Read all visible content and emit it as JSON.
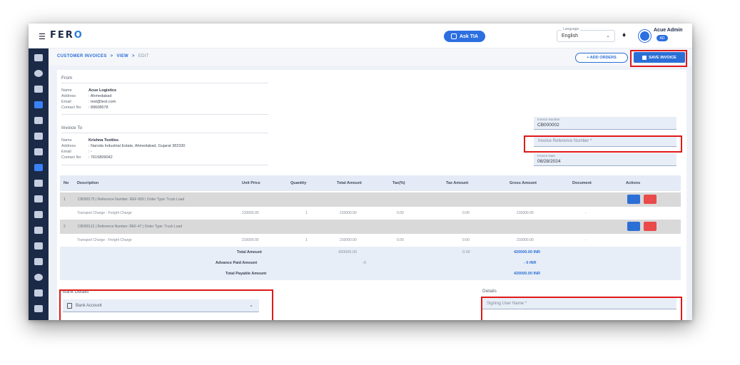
{
  "header": {
    "logo_prefix": "FER",
    "logo_suffix": "O",
    "ask_button": "Ask TIA",
    "language_label": "Language",
    "language_value": "English",
    "user_name": "Acue Admin",
    "user_role": "AD"
  },
  "breadcrumb": {
    "root": "CUSTOMER INVOICES",
    "mid": "VIEW",
    "current": "EDIT"
  },
  "actions": {
    "add_orders": "+ ADD ORDERS",
    "save_invoice": "SAVE INVOICE"
  },
  "from": {
    "title": "From",
    "name_key": "Name",
    "name": "Acue Logistics",
    "address_key": "Address",
    "address": ": Ahmedabad",
    "email_key": "Email",
    "email": ": test@test.com",
    "contact_key": "Contact No",
    "contact": ": 89608678"
  },
  "invoice_to": {
    "title": "Invoice To",
    "name_key": "Name",
    "name": "Krishna Textiles",
    "address_key": "Address",
    "address": ": Naroda Industrial Estate, Ahmedabad, Gujarat 382330",
    "email_key": "Email",
    "email": ": -",
    "contact_key": "Contact No",
    "contact": ": 7615809042"
  },
  "fields": {
    "invoice_number_label": "Invoice Number",
    "invoice_number": "CB000002",
    "ref_placeholder": "Invoice Reference Number *",
    "invoice_date_label": "Invoice Date",
    "invoice_date": "08/28/2024"
  },
  "table": {
    "headers": [
      "No",
      "Description",
      "Unit Price",
      "Quantity",
      "Total Amount",
      "Tax(%)",
      "Tax Amount",
      "Gross Amount",
      "Document",
      "Actions"
    ],
    "groups": [
      {
        "no": "1",
        "title": "CB000175 | Reference Number: REF-999 | Order Type: Truck Load",
        "row": {
          "description": "Transport Charge - Freight Charge",
          "unit_price": "210000.00",
          "qty": "1",
          "total": "210000.00",
          "tax_pct": "0.00",
          "tax_amount": "0.00",
          "gross": "210000.00",
          "document": "-"
        }
      },
      {
        "no": "2",
        "title": "CB000112 | Reference Number: REF-47 | Order Type: Truck Load",
        "row": {
          "description": "Transport Charge - Freight Charge",
          "unit_price": "210000.00",
          "qty": "1",
          "total": "210000.00",
          "tax_pct": "0.00",
          "tax_amount": "0.00",
          "gross": "210000.00",
          "document": "-"
        }
      }
    ],
    "totals": {
      "total_label": "Total Amount",
      "total_value": "420000.00",
      "tax_total": "0.00",
      "gross_total": "420000.00 INR",
      "advance_label": "Advance Paid Amount",
      "advance_value": "-0",
      "advance_gross": "- 0 INR",
      "payable_label": "Total Payable Amount",
      "payable_gross": "420000.00 INR"
    }
  },
  "bank": {
    "title": "Bank Details",
    "select": "Bank Account"
  },
  "details": {
    "title": "Details",
    "signing_placeholder": "Signing User Name *"
  }
}
